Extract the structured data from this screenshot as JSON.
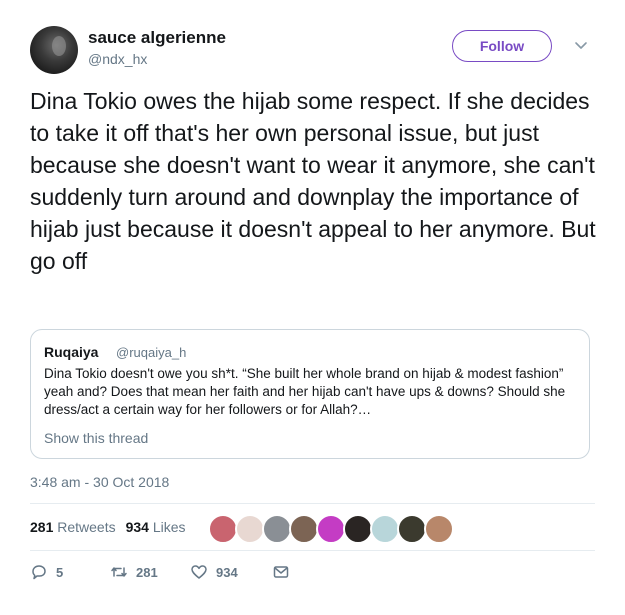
{
  "author": {
    "display_name": "sauce algerienne",
    "handle": "@ndx_hx"
  },
  "follow_label": "Follow",
  "tweet_text": "Dina Tokio owes the hijab some respect. If she decides to take it off that's her own personal issue, but just because she doesn't want to wear it anymore, she can't suddenly turn around and downplay the importance of hijab just because it doesn't appeal to her anymore. But go off",
  "quoted": {
    "display_name": "Ruqaiya",
    "handle": "@ruqaiya_h",
    "text": "Dina Tokio doesn't owe you sh*t. “She built her whole brand on hijab & modest fashion” yeah and? Does that mean her faith and her hijab can't have ups & downs? Should she dress/act a certain way for her followers or for Allah?…",
    "show_thread_label": "Show this thread"
  },
  "timestamp": "3:48 am - 30 Oct 2018",
  "stats": {
    "retweets_count": "281",
    "retweets_label": "Retweets",
    "likes_count": "934",
    "likes_label": "Likes"
  },
  "liker_avatars": [
    {
      "color": "#c9646f"
    },
    {
      "color": "#e8d8d2"
    },
    {
      "color": "#8a8f95"
    },
    {
      "color": "#7c6454"
    },
    {
      "color": "#c43cc4"
    },
    {
      "color": "#2a2523"
    },
    {
      "color": "#b8d6da"
    },
    {
      "color": "#3b3a2e"
    },
    {
      "color": "#b8876a"
    }
  ],
  "actions": {
    "replies": "5",
    "retweets": "281",
    "likes": "934"
  },
  "colors": {
    "accent": "#794bc4",
    "muted": "#657786",
    "border": "#ccd6dd"
  }
}
